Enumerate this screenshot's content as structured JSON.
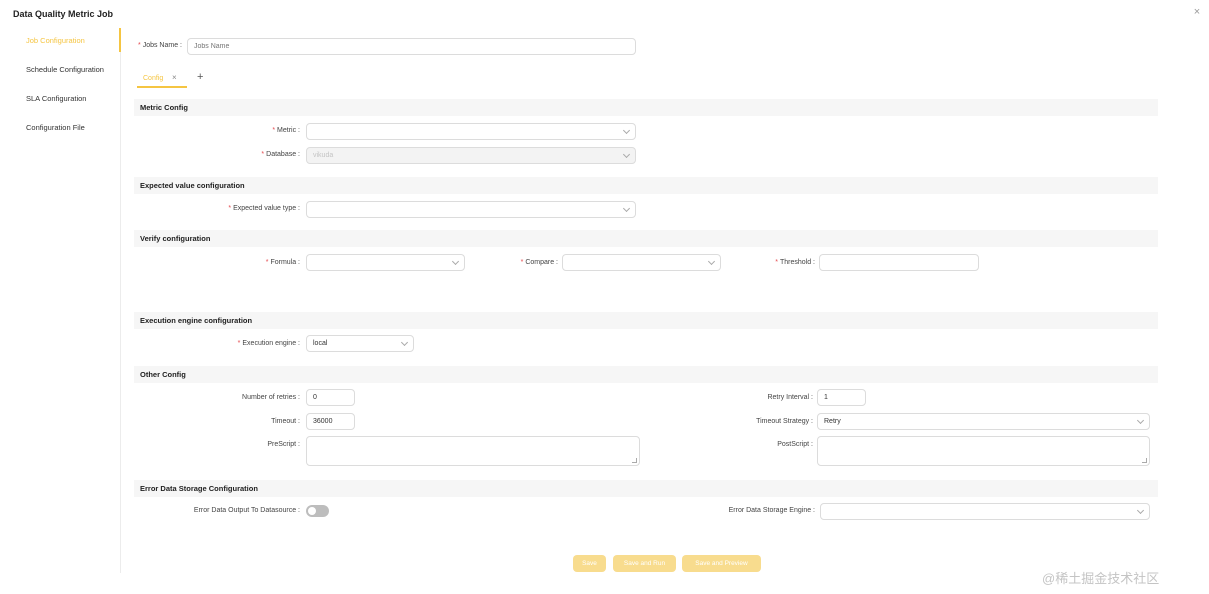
{
  "dialog": {
    "title": "Data Quality Metric Job",
    "close_glyph": "×"
  },
  "sidebar": {
    "items": [
      {
        "label": "Job Configuration",
        "active": true
      },
      {
        "label": "Schedule Configuration"
      },
      {
        "label": "SLA Configuration"
      },
      {
        "label": "Configuration File"
      }
    ]
  },
  "form": {
    "jobs_name": {
      "label": "Jobs Name :",
      "placeholder": "Jobs Name",
      "required": true
    },
    "tab": {
      "label": "Config",
      "close_glyph": "×",
      "add_glyph": "+"
    },
    "sections": {
      "metric": "Metric Config",
      "expected": "Expected value configuration",
      "verify": "Verify configuration",
      "engine": "Execution engine configuration",
      "other": "Other Config",
      "error_storage": "Error Data Storage Configuration"
    },
    "metric": {
      "label": "Metric :",
      "value": ""
    },
    "database": {
      "label": "Database :",
      "value": "vikuda"
    },
    "expected_value_type": {
      "label": "Expected value type :",
      "value": ""
    },
    "formula": {
      "label": "Formula :",
      "value": ""
    },
    "compare": {
      "label": "Compare :",
      "value": ""
    },
    "threshold": {
      "label": "Threshold :",
      "value": ""
    },
    "execution_engine": {
      "label": "Execution engine :",
      "value": "local"
    },
    "retries": {
      "label": "Number of retries :",
      "value": "0"
    },
    "retry_interval": {
      "label": "Retry Interval :",
      "value": "1"
    },
    "timeout": {
      "label": "Timeout :",
      "value": "36000"
    },
    "timeout_strategy": {
      "label": "Timeout Strategy :",
      "value": "Retry"
    },
    "prescript": {
      "label": "PreScript :"
    },
    "postscript": {
      "label": "PostScript :"
    },
    "error_output": {
      "label": "Error Data Output To Datasource :",
      "enabled": false
    },
    "error_engine": {
      "label": "Error Data Storage Engine :",
      "value": ""
    }
  },
  "buttons": {
    "save": "Save",
    "save_and_run": "Save and Run",
    "save_and_preview": "Save and Preview"
  },
  "watermark": "@稀土掘金技术社区",
  "colors": {
    "accent": "#f5c542",
    "button": "#f8dc8e",
    "required": "#e5484d",
    "section_bg": "#f6f6f6"
  }
}
